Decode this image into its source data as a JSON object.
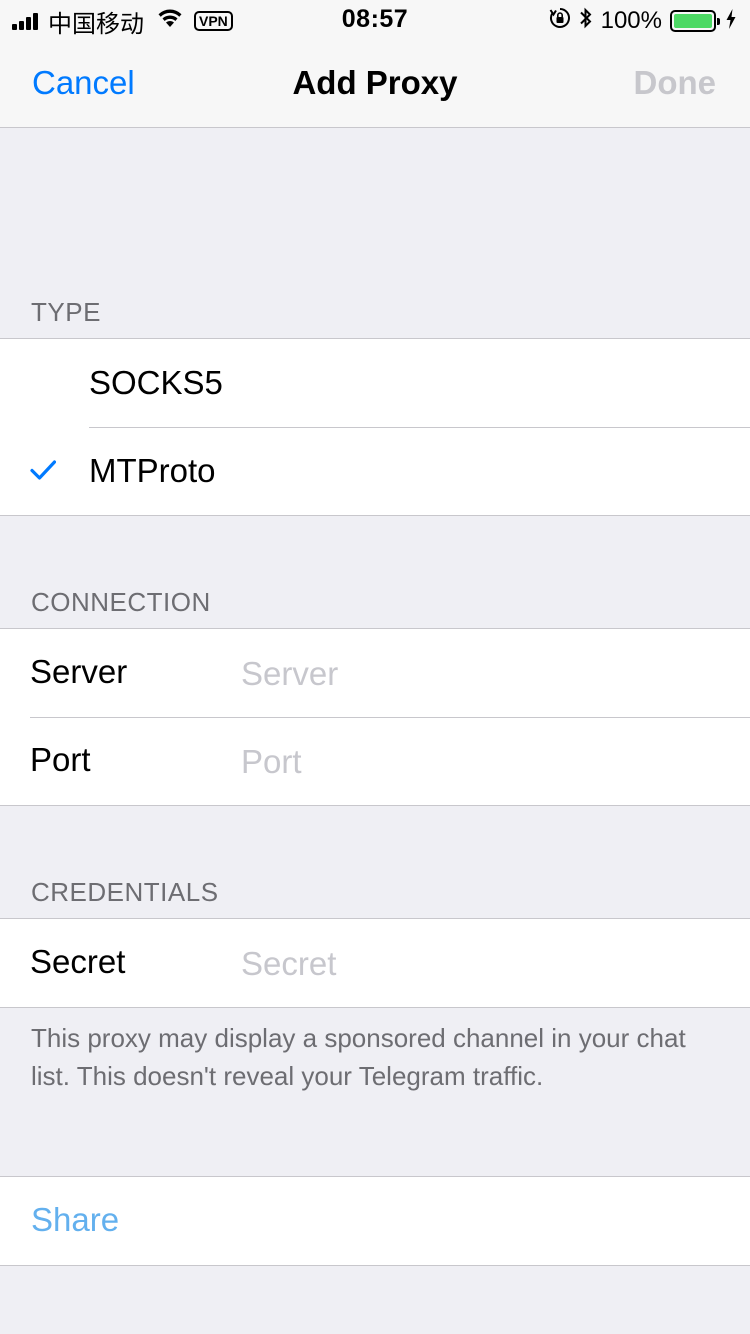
{
  "status_bar": {
    "carrier": "中国移动",
    "vpn": "VPN",
    "time": "08:57",
    "battery": "100%",
    "battery_level_percent": 100,
    "icons": [
      "signal-icon",
      "wifi-icon",
      "vpn-badge",
      "orientation-lock-icon",
      "bluetooth-icon",
      "battery-icon",
      "charging-icon"
    ]
  },
  "nav": {
    "cancel": "Cancel",
    "title": "Add Proxy",
    "done": "Done"
  },
  "type_section": {
    "header": "TYPE",
    "options": [
      {
        "label": "SOCKS5",
        "selected": false
      },
      {
        "label": "MTProto",
        "selected": true
      }
    ]
  },
  "connection_section": {
    "header": "CONNECTION",
    "server_label": "Server",
    "server_placeholder": "Server",
    "server_value": "",
    "port_label": "Port",
    "port_placeholder": "Port",
    "port_value": ""
  },
  "credentials_section": {
    "header": "CREDENTIALS",
    "secret_label": "Secret",
    "secret_placeholder": "Secret",
    "secret_value": "",
    "footer": "This proxy may display a sponsored channel in your chat list. This doesn't reveal your Telegram traffic."
  },
  "share": {
    "label": "Share"
  },
  "colors": {
    "accent": "#007aff",
    "disabled": "#c7c7cc",
    "share_link": "#63b0ee",
    "background": "#efeff4",
    "battery_fill": "#4cd964"
  }
}
